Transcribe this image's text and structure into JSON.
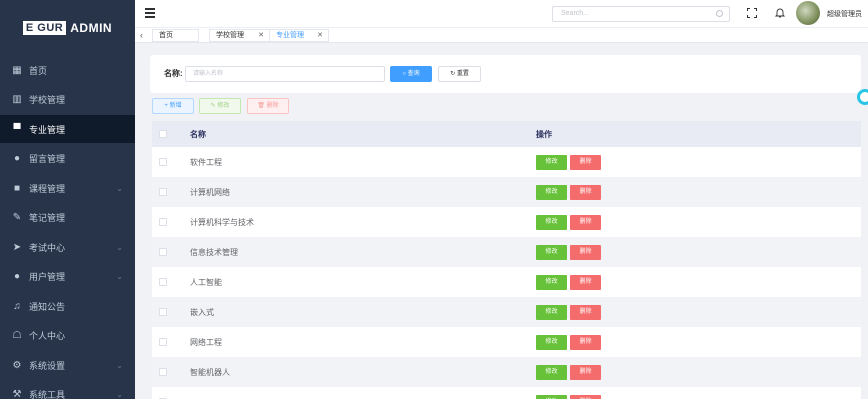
{
  "logo": {
    "box": "E GUR",
    "text": "ADMIN"
  },
  "sidebar": {
    "items": [
      {
        "label": "首页",
        "icon": "grid-icon",
        "glyph": "▦",
        "active": false,
        "caret": false
      },
      {
        "label": "学校管理",
        "icon": "building-icon",
        "glyph": "▥",
        "active": false,
        "caret": false
      },
      {
        "label": "专业管理",
        "icon": "monitor-icon",
        "glyph": "▀",
        "active": true,
        "caret": false
      },
      {
        "label": "留言管理",
        "icon": "question-icon",
        "glyph": "●",
        "active": false,
        "caret": false
      },
      {
        "label": "课程管理",
        "icon": "clipboard-icon",
        "glyph": "■",
        "active": false,
        "caret": true
      },
      {
        "label": "笔记管理",
        "icon": "edit-icon",
        "glyph": "✎",
        "active": false,
        "caret": false
      },
      {
        "label": "考试中心",
        "icon": "send-icon",
        "glyph": "➤",
        "active": false,
        "caret": true
      },
      {
        "label": "用户管理",
        "icon": "info-icon",
        "glyph": "●",
        "active": false,
        "caret": true
      },
      {
        "label": "通知公告",
        "icon": "bell-icon",
        "glyph": "♫",
        "active": false,
        "caret": false
      },
      {
        "label": "个人中心",
        "icon": "user-icon",
        "glyph": "☖",
        "active": false,
        "caret": false
      },
      {
        "label": "系统设置",
        "icon": "gear-icon",
        "glyph": "⚙",
        "active": false,
        "caret": true
      },
      {
        "label": "系统工具",
        "icon": "tool-icon",
        "glyph": "⚒",
        "active": false,
        "caret": true
      }
    ]
  },
  "header": {
    "search_placeholder": "Search...",
    "username": "超级管理员"
  },
  "tabs": [
    {
      "label": "首页",
      "closable": false,
      "active": false
    },
    {
      "label": "学校管理",
      "closable": true,
      "active": false
    },
    {
      "label": "专业管理",
      "closable": true,
      "active": true
    }
  ],
  "filter": {
    "name_label": "名称:",
    "name_placeholder": "请输入名称",
    "query_label": "查询",
    "reset_label": "重置"
  },
  "toolbar": {
    "add_label": "+ 新增",
    "edit_label": "✎ 修改",
    "delete_label": "🗑 删除"
  },
  "table": {
    "headers": [
      "名称",
      "操作"
    ],
    "rows": [
      {
        "name": "软件工程"
      },
      {
        "name": "计算机网络"
      },
      {
        "name": "计算机科学与技术"
      },
      {
        "name": "信息技术管理"
      },
      {
        "name": "人工智能"
      },
      {
        "name": "嵌入式"
      },
      {
        "name": "网络工程"
      },
      {
        "name": "智能机器人"
      },
      {
        "name": ""
      }
    ],
    "edit_label": "修改",
    "delete_label": "删除"
  },
  "colors": {
    "sidebar_bg": "#28344a",
    "primary": "#409eff",
    "success": "#67c23a",
    "danger": "#f56c6c"
  }
}
